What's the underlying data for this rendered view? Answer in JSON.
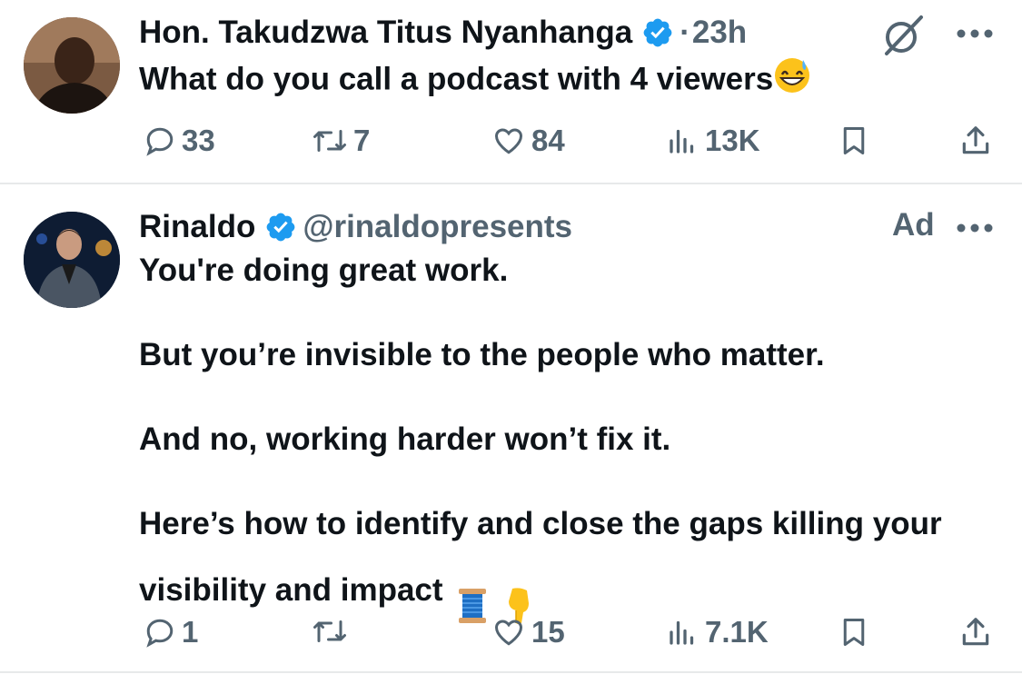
{
  "tweets": [
    {
      "author_name": "Hon. Takudzwa Titus Nyanhanga",
      "verified": true,
      "separator": "·",
      "timestamp": "23h",
      "text": "What do you call a podcast with 4 viewers",
      "text_emoji": "grinning-face-with-sweat",
      "icons": [
        "grok-icon",
        "more-icon"
      ],
      "actions": {
        "replies": "33",
        "reposts": "7",
        "likes": "84",
        "views": "13K"
      }
    },
    {
      "author_name": "Rinaldo",
      "verified": true,
      "handle": "@rinaldopresents",
      "ad_label": "Ad",
      "text_lines": [
        "You're doing great work.",
        "But you’re invisible to the people who matter.",
        "And no, working harder won’t fix it.",
        "Here’s how to identify and close the gaps killing your",
        "visibility and impact"
      ],
      "text_emojis": [
        "thread-spool",
        "backhand-index-pointing-down"
      ],
      "actions": {
        "replies": "1",
        "reposts": "",
        "likes": "15",
        "views": "7.1K"
      }
    }
  ],
  "colors": {
    "text": "#0f1419",
    "secondary": "#536471",
    "verified_blue": "#1d9bf0",
    "divider": "#e7e9ea"
  }
}
